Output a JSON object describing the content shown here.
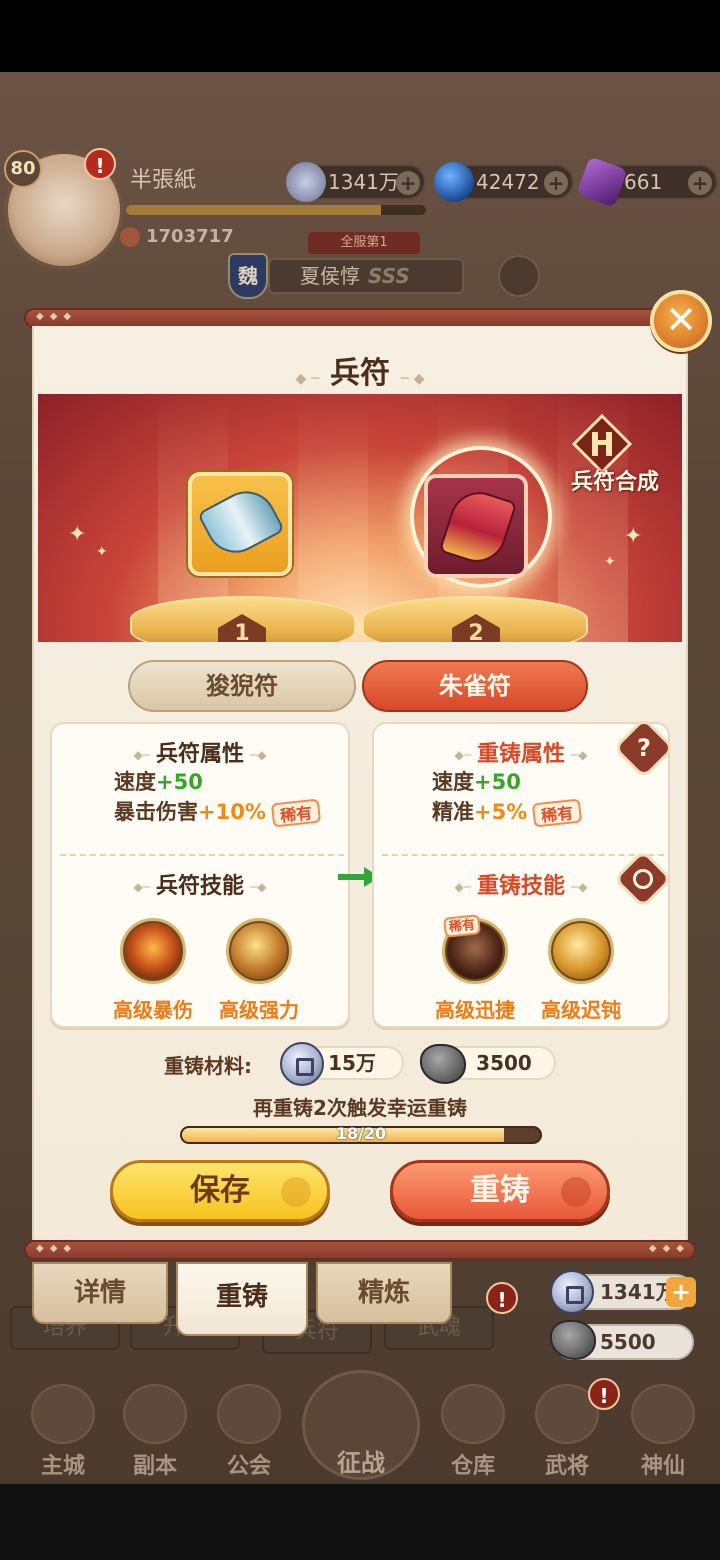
{
  "player": {
    "level": "80",
    "name": "半張紙",
    "power": "1703717",
    "alert": "!"
  },
  "top_resources": [
    {
      "value": "1341万",
      "icon": "copper-coin-icon"
    },
    {
      "value": "42472",
      "icon": "blue-orb-icon"
    },
    {
      "value": "661",
      "icon": "purple-crystal-icon"
    }
  ],
  "hero": {
    "rank_ribbon": "全服第1",
    "faction": "魏",
    "name": "夏侯惇",
    "grade": "SSS"
  },
  "background_tabs": [
    "培养",
    "升星",
    "兵符",
    "武魂"
  ],
  "dialog": {
    "title": "兵符",
    "synth_label": "兵符合成",
    "slot_numbers": [
      "1",
      "2"
    ],
    "type_tabs": [
      {
        "label": "狻猊符",
        "active": false
      },
      {
        "label": "朱雀符",
        "active": true
      }
    ],
    "left_card": {
      "attr_title": "兵符属性",
      "attrs": [
        {
          "name": "速度",
          "value": "+50",
          "rare": ""
        },
        {
          "name": "暴击伤害",
          "value": "+10%",
          "rare": "稀有"
        }
      ],
      "skill_title": "兵符技能",
      "skills": [
        "高级暴伤",
        "高级强力"
      ]
    },
    "right_card": {
      "attr_title": "重铸属性",
      "attrs": [
        {
          "name": "速度",
          "value": "+50",
          "rare": ""
        },
        {
          "name": "精准",
          "value": "+5%",
          "rare": "稀有"
        }
      ],
      "skill_title": "重铸技能",
      "skills": [
        "高级迅捷",
        "高级迟钝"
      ],
      "skill_rare_tag": "稀有",
      "help": "?"
    },
    "materials_label": "重铸材料:",
    "materials": [
      {
        "value": "15万",
        "icon": "coin-icon"
      },
      {
        "value": "3500",
        "icon": "stone-icon"
      }
    ],
    "lucky_hint": "再重铸2次触发幸运重铸",
    "progress": {
      "current": 18,
      "max": 20,
      "text": "18/20"
    },
    "save_label": "保存",
    "reforge_label": "重铸",
    "close": "✕"
  },
  "footer_tabs": [
    {
      "label": "详情",
      "active": false
    },
    {
      "label": "重铸",
      "active": true
    },
    {
      "label": "精炼",
      "active": false
    }
  ],
  "bottom_resources": [
    {
      "value": "1341万",
      "icon": "coin-icon",
      "plus": "+"
    },
    {
      "value": "5500",
      "icon": "stone-icon"
    }
  ],
  "bottom_nav": [
    "主城",
    "副本",
    "公会",
    "征战",
    "仓库",
    "武将",
    "神仙"
  ],
  "colors": {
    "accent_red": "#d6482a",
    "gold": "#f7c21e",
    "green_plus": "#36a52a",
    "orange_plus": "#f08a16",
    "skill_text": "#f07a16"
  }
}
